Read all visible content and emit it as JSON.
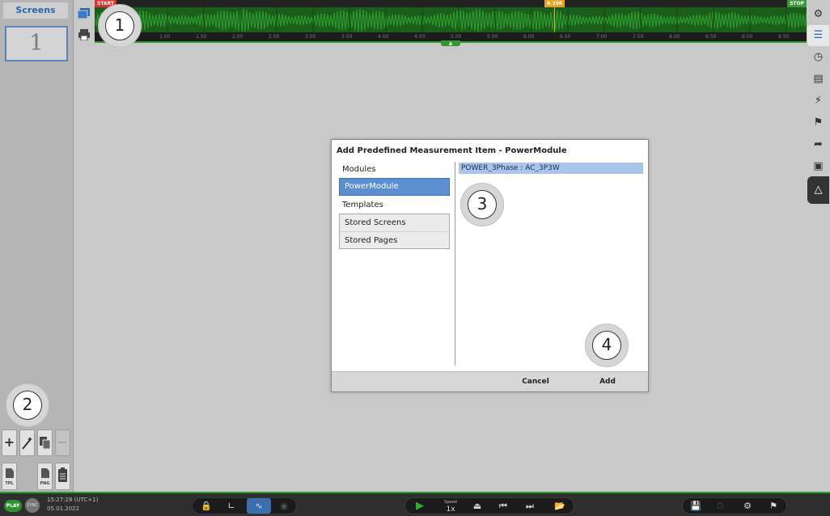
{
  "screens_panel": {
    "header": "Screens",
    "thumbnail_label": "1",
    "tools": [
      "+",
      "−"
    ],
    "file_buttons": [
      "TPL",
      "PNG"
    ]
  },
  "waveform": {
    "start_label": "START",
    "stop_label": "STOP",
    "cursor_value": "6.298",
    "axis_ticks": [
      "1.00",
      "1.50",
      "2.00",
      "2.50",
      "3.00",
      "3.50",
      "4.00",
      "4.50",
      "5.00",
      "5.50",
      "6.00",
      "6.50",
      "7.00",
      "7.50",
      "8.00",
      "8.50",
      "9.00",
      "9.50"
    ]
  },
  "right_sidebar": {
    "items": [
      "settings-icon",
      "list-icon",
      "gauge-icon",
      "report-icon",
      "lightning-icon",
      "flag-icon",
      "export-icon",
      "car-icon",
      "warning-icon"
    ]
  },
  "dialog": {
    "title": "Add Predefined Measurement Item - PowerModule",
    "modules_label": "Modules",
    "module_selected": "PowerModule",
    "templates_label": "Templates",
    "templates": [
      "Stored Screens",
      "Stored Pages"
    ],
    "items": [
      "POWER_3Phase : AC_3P3W"
    ],
    "cancel_label": "Cancel",
    "add_label": "Add"
  },
  "callouts": [
    "1",
    "2",
    "3",
    "4"
  ],
  "status": {
    "play_label": "PLAY",
    "sync_label": "SYNC",
    "time": "15:27:28 (UTC+1)",
    "date": "05.01.2022",
    "speed_label": "Speed",
    "speed_value": "1x"
  },
  "colors": {
    "accent": "#5b8fcf",
    "waveform": "#2d9a2d",
    "cursor": "#e8a316"
  }
}
